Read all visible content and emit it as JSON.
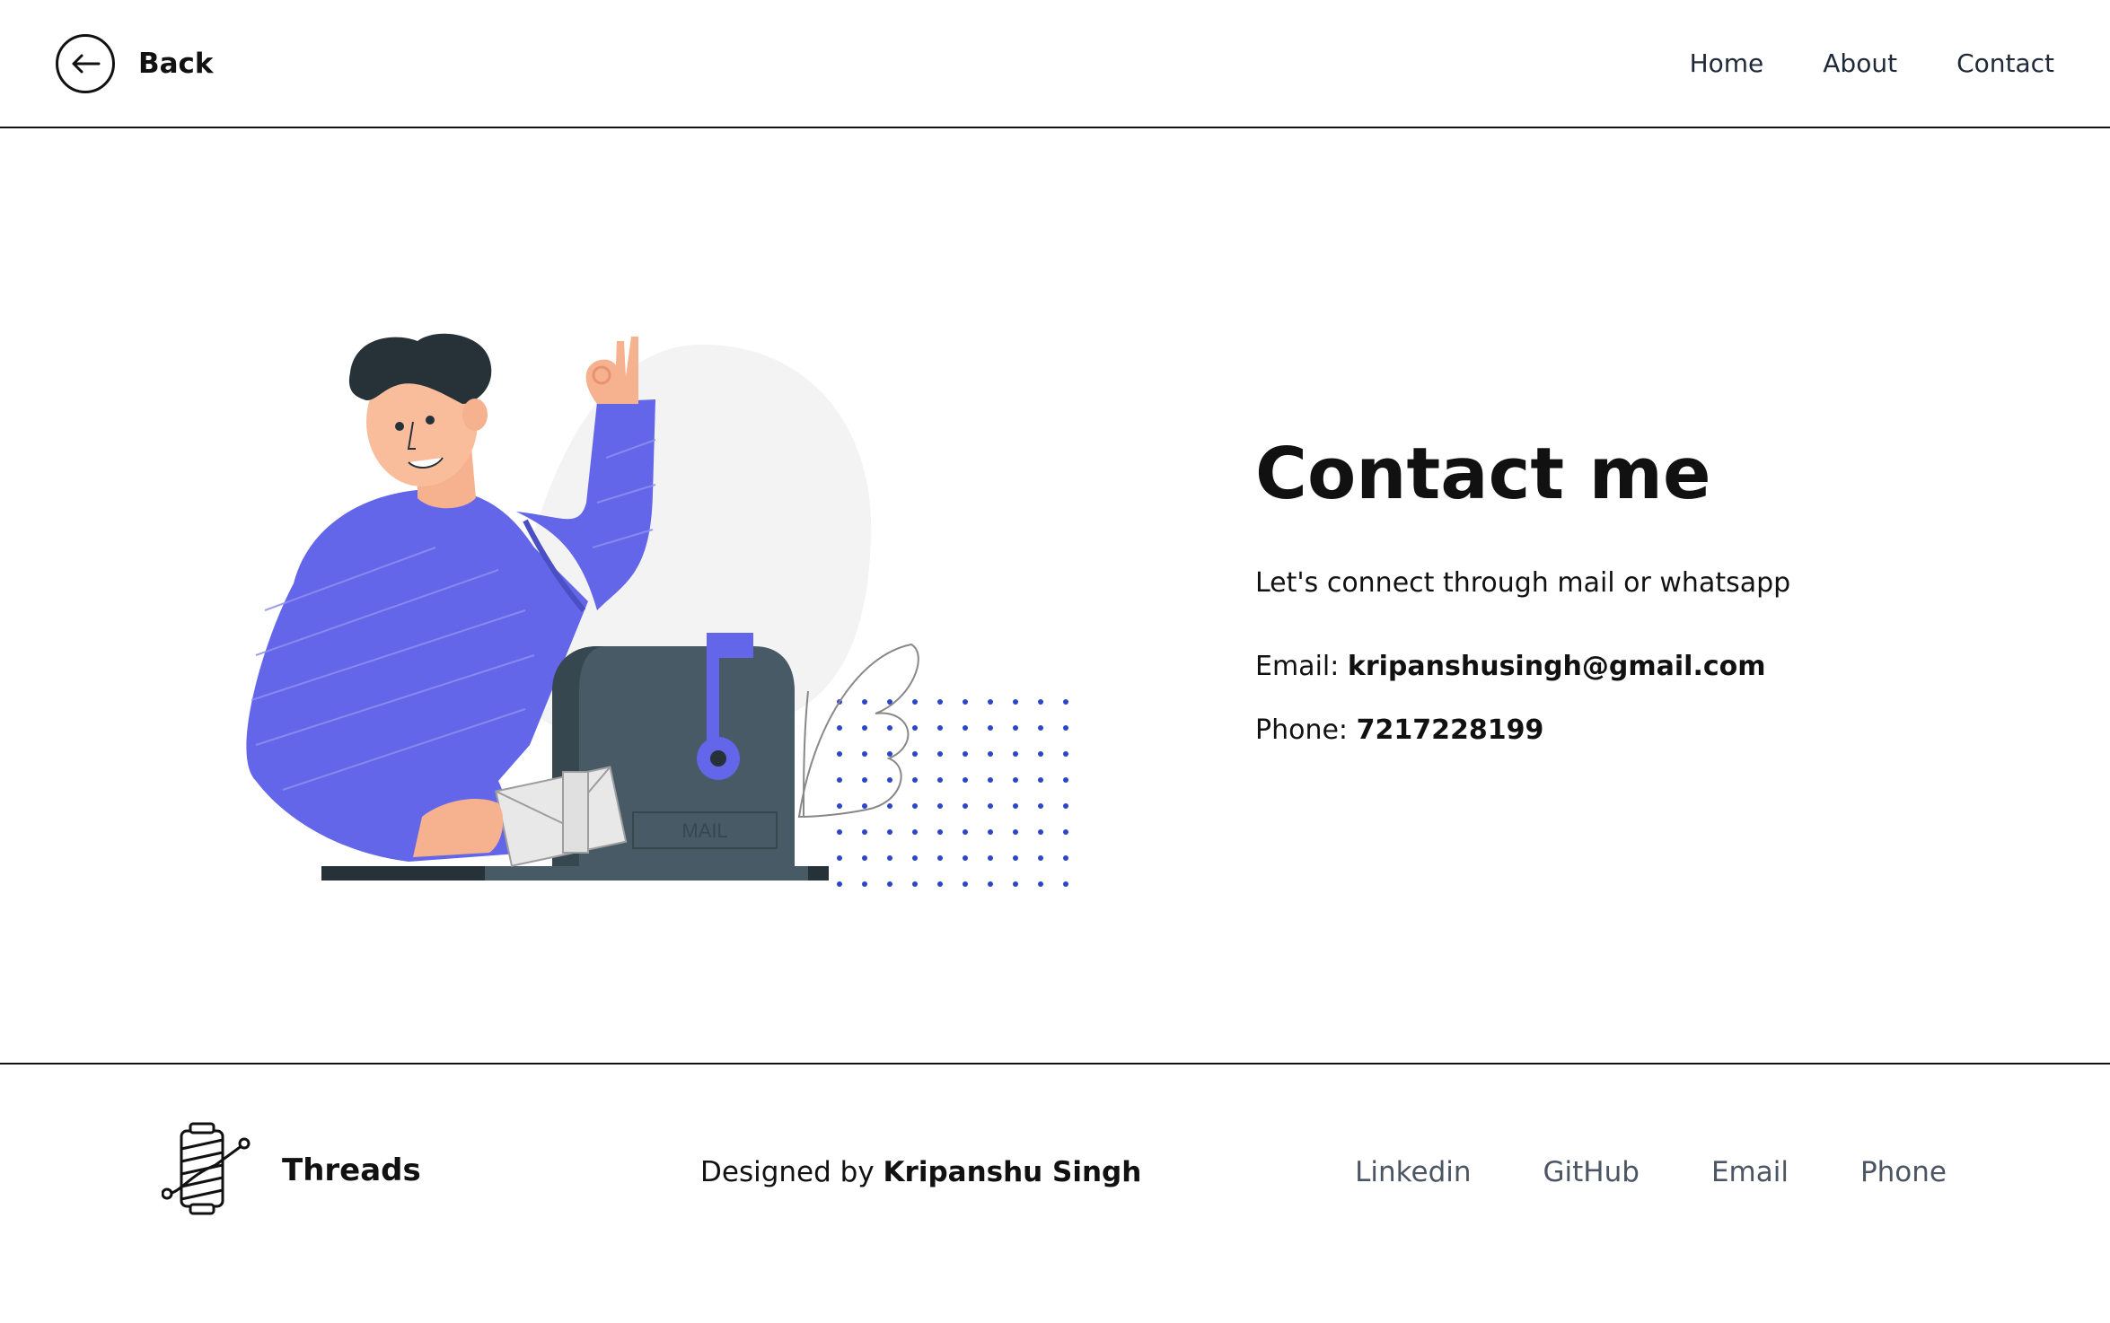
{
  "header": {
    "back_label": "Back",
    "nav": [
      {
        "label": "Home"
      },
      {
        "label": "About"
      },
      {
        "label": "Contact"
      }
    ]
  },
  "illustration": {
    "mailbox_label": "MAIL"
  },
  "contact": {
    "title": "Contact me",
    "subtitle": "Let's connect through mail or whatsapp",
    "email_label": "Email:",
    "email_value": "kripanshusingh@gmail.com",
    "phone_label": "Phone:",
    "phone_value": "7217228199"
  },
  "footer": {
    "brand_name": "Threads",
    "credit_prefix": "Designed by",
    "credit_name": "Kripanshu Singh",
    "links": [
      {
        "label": "Linkedin"
      },
      {
        "label": "GitHub"
      },
      {
        "label": "Email"
      },
      {
        "label": "Phone"
      }
    ]
  },
  "colors": {
    "accent": "#6366e8",
    "mailbox": "#475a66",
    "dots": "#2f45c8"
  }
}
